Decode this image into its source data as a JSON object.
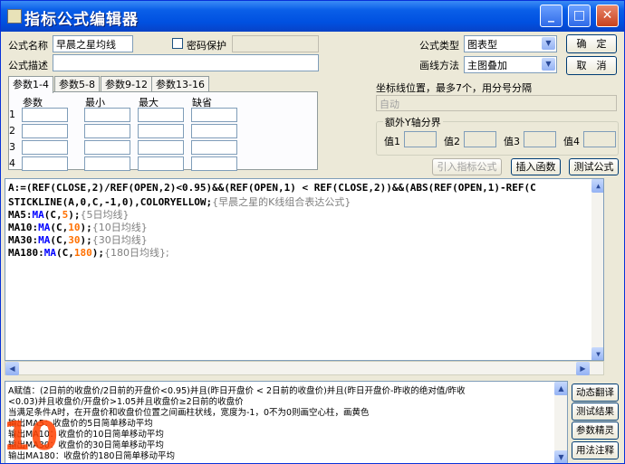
{
  "window": {
    "title": "指标公式编辑器"
  },
  "form": {
    "name_label": "公式名称",
    "name_value": "早晨之星均线",
    "password_label": "密码保护",
    "desc_label": "公式描述",
    "desc_value": "",
    "type_label": "公式类型",
    "type_value": "图表型",
    "draw_label": "画线方法",
    "draw_value": "主图叠加",
    "ok_label": "确　定",
    "cancel_label": "取　消"
  },
  "tabs": [
    "参数1-4",
    "参数5-8",
    "参数9-12",
    "参数13-16"
  ],
  "params": {
    "headers": [
      "参数",
      "最小",
      "最大",
      "缺省"
    ],
    "rows": [
      "1",
      "2",
      "3",
      "4"
    ]
  },
  "axis": {
    "label": "坐标线位置，最多7个，用分号分隔",
    "placeholder": "自动"
  },
  "extra_y": {
    "title": "额外Y轴分界",
    "labels": [
      "值1",
      "值2",
      "值3",
      "值4"
    ]
  },
  "buttons": {
    "import_label": "引入指标公式",
    "insert_label": "插入函数",
    "test_label": "测试公式"
  },
  "code": {
    "line1": "A:=(REF(CLOSE,2)/REF(OPEN,2)<0.95)&&(REF(OPEN,1) < REF(CLOSE,2))&&(ABS(REF(OPEN,1)-REF(C",
    "line2": "STICKLINE(A,0,C,-1,0),COLORYELLOW;",
    "line2_comment": "{早晨之星的K线组合表达公式}",
    "ma5_name": "MA5:",
    "ma5_func": "MA",
    "ma5_open": "(C,",
    "ma5_num": "5",
    "ma5_close": ");",
    "ma5_comment": "{5日均线}",
    "ma10_name": "MA10:",
    "ma10_func": "MA",
    "ma10_open": "(C,",
    "ma10_num": "10",
    "ma10_close": ");",
    "ma10_comment": "{10日均线}",
    "ma30_name": "MA30:",
    "ma30_func": "MA",
    "ma30_open": "(C,",
    "ma30_num": "30",
    "ma30_close": ");",
    "ma30_comment": "{30日均线}",
    "ma180_name": "MA180:",
    "ma180_func": "MA",
    "ma180_open": "(C,",
    "ma180_num": "180",
    "ma180_close": ");",
    "ma180_comment": "{180日均线};"
  },
  "description": {
    "line1": "A赋值：(2日前的收盘价/2日前的开盘价<0.95)并且(昨日开盘价 < 2日前的收盘价)并且(昨日开盘价-昨收的绝对值/昨收",
    "line2": "<0.03)并且收盘价/开盘价>1.05并且收盘价≥2日前的收盘价",
    "line3": "当满足条件A时，在开盘价和收盘价位置之间画柱状线，宽度为-1，0不为0则画空心柱，画黄色",
    "line4": "输出MA5：收盘价的5日简单移动平均",
    "line5": "输出MA10：收盘价的10日简单移动平均",
    "line6": "输出MA30：收盘价的30日简单移动平均",
    "line7": "输出MA180：收盘价的180日简单移动平均"
  },
  "side_buttons": {
    "translate": "动态翻译",
    "result": "测试结果",
    "wizard": "参数精灵",
    "usage": "用法注释"
  },
  "watermark": "10"
}
